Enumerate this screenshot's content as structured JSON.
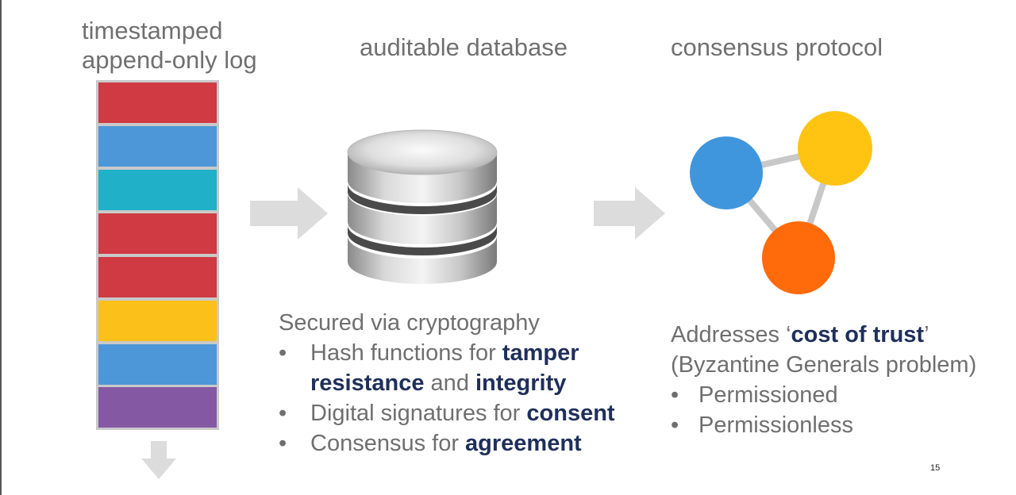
{
  "colors": {
    "heading_text": "#707070",
    "body_text": "#6f6f6f",
    "emphasis": "#1f2f5b",
    "arrow": "#dcdcdc",
    "log_red": "#cf3a43",
    "log_blue": "#4d97d8",
    "log_teal": "#20b0c8",
    "log_yellow": "#fcc01a",
    "log_purple": "#8558a4",
    "node_blue": "#3f96dc",
    "node_yellow": "#ffc312",
    "node_orange": "#ff6a0a",
    "node_edge": "#c8c8c8"
  },
  "headings": {
    "log_line1": "timestamped",
    "log_line2": "append-only log",
    "database": "auditable database",
    "consensus": "consensus protocol"
  },
  "log_blocks": [
    "red",
    "blue",
    "teal",
    "red",
    "red",
    "yellow",
    "blue",
    "purple"
  ],
  "database_text": {
    "intro": "Secured via cryptography",
    "bullet_char": "•",
    "b1_pre": "Hash functions for ",
    "b1_em1": "tamper",
    "b1_em2": "resistance",
    "b1_mid": " and ",
    "b1_em3": "integrity",
    "b2_pre": "Digital signatures for ",
    "b2_em": "consent",
    "b3_pre": "Consensus for ",
    "b3_em": "agreement"
  },
  "consensus_text": {
    "intro_pre": "Addresses ‘",
    "intro_em": "cost of trust",
    "intro_post": "’",
    "line2": "(Byzantine Generals problem)",
    "bullet_char": "•",
    "b1": "Permissioned",
    "b2": "Permissionless"
  },
  "page_number": "15",
  "icons": {
    "arrow_right": "arrow-right-icon",
    "arrow_down": "arrow-down-icon",
    "database": "database-icon",
    "network": "network-nodes-icon"
  }
}
